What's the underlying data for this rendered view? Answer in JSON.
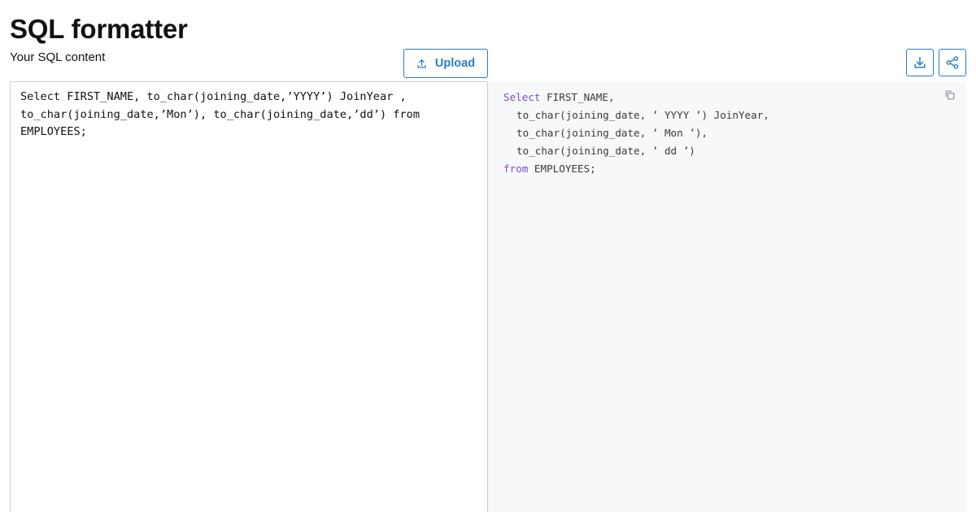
{
  "page": {
    "title": "SQL formatter",
    "input_label": "Your SQL content"
  },
  "toolbar": {
    "upload_label": "Upload",
    "upload_icon": "upload-icon",
    "download_icon": "download-icon",
    "share_icon": "share-icon",
    "accent_color": "#2b7fc3"
  },
  "editor": {
    "input_value": "Select FIRST_NAME, to_char(joining_date,’YYYY’) JoinYear , to_char(joining_date,’Mon’), to_char(joining_date,’dd’) from EMPLOYEES;"
  },
  "output": {
    "copy_icon": "copy-icon",
    "keyword_color": "#7c4dbd",
    "lines": [
      {
        "keyword": "Select",
        "text": " FIRST_NAME,",
        "indent": false
      },
      {
        "keyword": "",
        "text": "to_char(joining_date, ’ YYYY ’) JoinYear,",
        "indent": true
      },
      {
        "keyword": "",
        "text": "to_char(joining_date, ’ Mon ’),",
        "indent": true
      },
      {
        "keyword": "",
        "text": "to_char(joining_date, ’ dd ’)",
        "indent": true
      },
      {
        "keyword": "from",
        "text": " EMPLOYEES;",
        "indent": false
      }
    ]
  }
}
